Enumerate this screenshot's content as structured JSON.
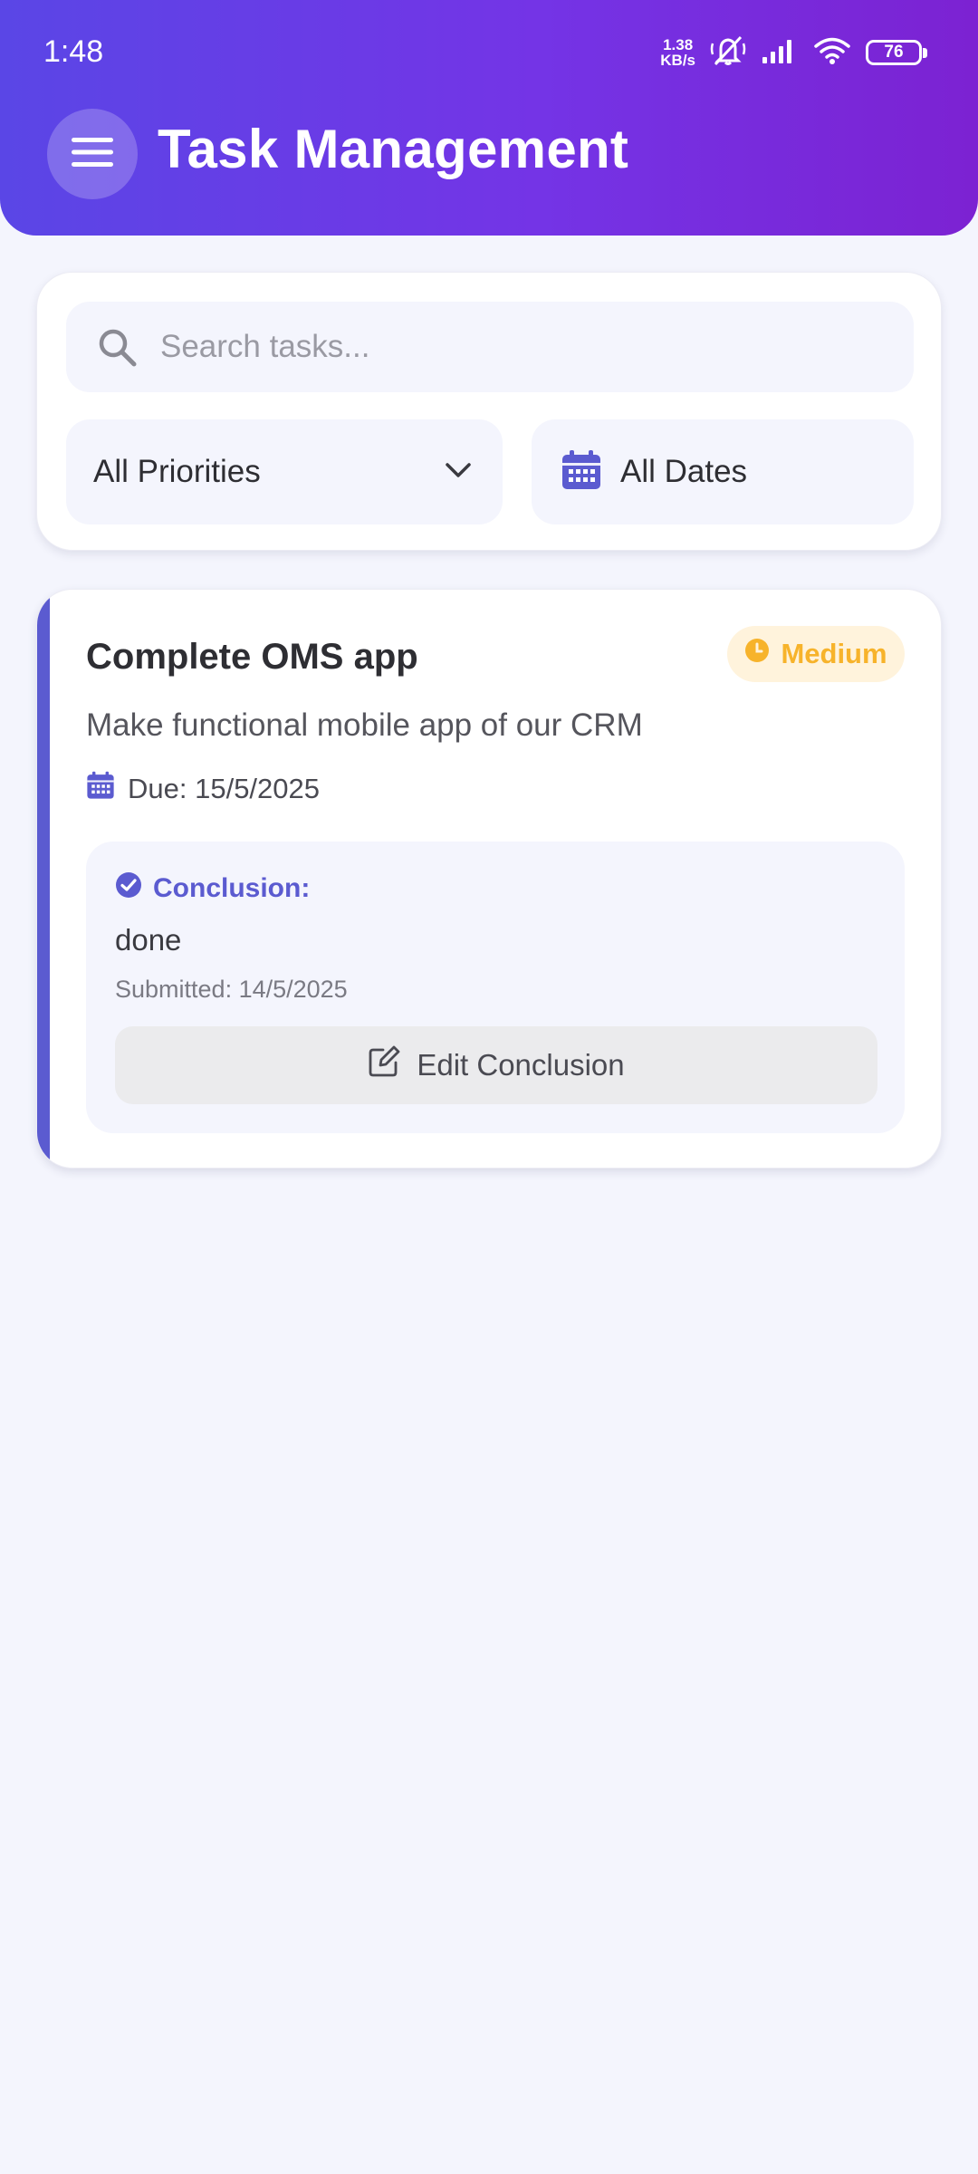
{
  "status_bar": {
    "time": "1:48",
    "net_speed_value": "1.38",
    "net_speed_unit": "KB/s",
    "battery": "76",
    "icons": [
      "mute-icon",
      "signal-icon",
      "wifi-icon",
      "battery-icon"
    ]
  },
  "header": {
    "title": "Task Management",
    "menu_icon": "hamburger-menu-icon"
  },
  "filters": {
    "search_placeholder": "Search tasks...",
    "search_value": "",
    "priority_selected": "All Priorities",
    "date_selected": "All Dates"
  },
  "tasks": [
    {
      "title": "Complete OMS app",
      "priority": "Medium",
      "priority_color": "#f7b32b",
      "description": "Make functional mobile app of our CRM",
      "due": "Due: 15/5/2025",
      "conclusion_label": "Conclusion:",
      "conclusion_text": "done",
      "submitted": "Submitted: 14/5/2025",
      "edit_label": "Edit Conclusion"
    }
  ],
  "colors": {
    "accent": "#5b5bd0",
    "header_gradient_start": "#5a46e6",
    "header_gradient_end": "#7c22d2",
    "background": "#f4f5fd"
  }
}
